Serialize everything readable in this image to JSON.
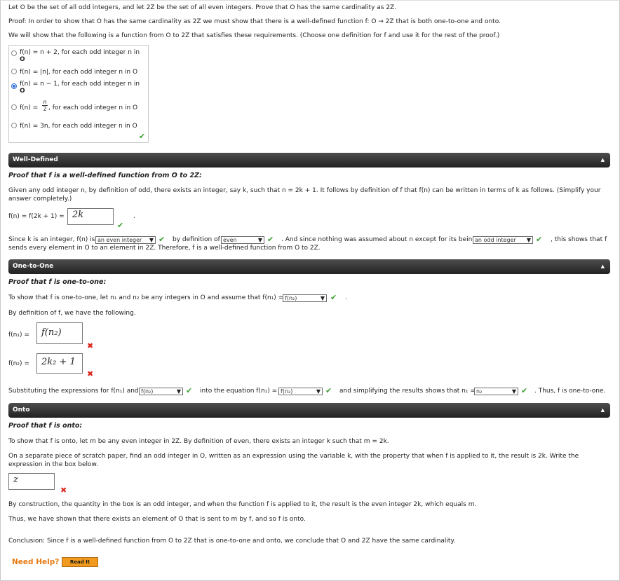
{
  "problem": {
    "statement": "Let O be the set of all odd integers, and let 2Z be the set of all even integers. Prove that O has the same cardinality as 2Z.",
    "proof_intro": "Proof: In order to show that O has the same cardinality as 2Z we must show that there is a well-defined function f: O → 2Z that is both one-to-one and onto.",
    "choose_line": "We will show that the following is a function from O to 2Z that satisfies these requirements. (Choose one definition for f and use it for the rest of the proof.)"
  },
  "choices": [
    {
      "line1": "f(n) = n + 2, for each odd integer n in",
      "line2": "O",
      "selected": false
    },
    {
      "line1": "f(n) = |n|, for each odd integer n in O",
      "line2": "",
      "selected": false
    },
    {
      "line1": "f(n) = n − 1, for each odd integer n in",
      "line2": "O",
      "selected": true
    },
    {
      "line1": "f(n) = ",
      "frac_num": "n",
      "frac_den": "2",
      "line1b": ", for each odd integer n in O",
      "selected": false
    },
    {
      "line1": "f(n) = 3n, for each odd integer n in O",
      "line2": "",
      "selected": false
    }
  ],
  "well_defined": {
    "bar": "Well-Defined",
    "heading": "Proof that f is a well-defined function from O to 2Z:",
    "para": "Given any odd integer n, by definition of odd, there exists an integer, say k, such that n = 2k + 1. It follows by definition of f that f(n) can be written in terms of k as follows. (Simplify your answer completely.)",
    "eq_label": "f(n) = f(2k + 1) =",
    "eq_answer": "2k",
    "eq_period": ".",
    "since_a": "Since k is an integer, f(n) is",
    "sel1": "an even integer",
    "since_b": "by definition of",
    "sel2": "even",
    "since_c": ". And since nothing was assumed about n except for its being",
    "sel3": "an odd integer",
    "since_d": ", this shows that f",
    "since_e": "sends every element in O to an element in 2Z. Therefore, f is a well-defined function from O to 2Z."
  },
  "one_to_one": {
    "bar": "One-to-One",
    "heading": "Proof that f is one-to-one:",
    "line1": "To show that f is one-to-one, let n₁ and n₂ be any integers in O and assume that f(n₁) =",
    "sel_main": "f(n₂)",
    "line1_end": ".",
    "line2": "By definition of f, we have the following.",
    "eq1_label": "f(n₁) =",
    "eq1_answer": "f(n₂)",
    "eq2_label": "f(n₂) =",
    "eq2_answer": "2k₂ + 1",
    "sub_a": "Substituting the expressions for f(n₁) and",
    "sub_sel1": "f(n₂)",
    "sub_b": "into the equation f(n₁) =",
    "sub_sel2": "f(n₂)",
    "sub_c": "and simplifying the results shows that n₁ =",
    "sub_sel3": "n₂",
    "sub_d": ". Thus, f is one-to-one."
  },
  "onto": {
    "bar": "Onto",
    "heading": "Proof that f is onto:",
    "line1": "To show that f is onto, let m be any even integer in 2Z. By definition of even, there exists an integer k such that m = 2k.",
    "line2": "On a separate piece of scratch paper, find an odd integer in O, written as an expression using the variable k, with the property that when f is applied to it, the result is 2k. Write the expression in the box below.",
    "answer": "z",
    "line3": "By construction, the quantity in the box is an odd integer, and when the function f is applied to it, the result is the even integer 2k, which equals m.",
    "line4": "Thus, we have shown that there exists an element of O that is sent to m by f, and so f is onto."
  },
  "conclusion": "Conclusion: Since f is a well-defined function from O to 2Z that is one-to-one and onto, we conclude that O and 2Z have the same cardinality.",
  "help": {
    "label": "Need Help?",
    "read_it": "Read It"
  },
  "marks": {
    "check": "✔",
    "cross": "✖",
    "arrow_up": "▲",
    "chevron": "▼"
  },
  "colors": {
    "check": "#3ba02f",
    "cross": "#d9281f",
    "bar": "#2b2b2b",
    "help": "#e8780f",
    "button": "#f09b20"
  }
}
